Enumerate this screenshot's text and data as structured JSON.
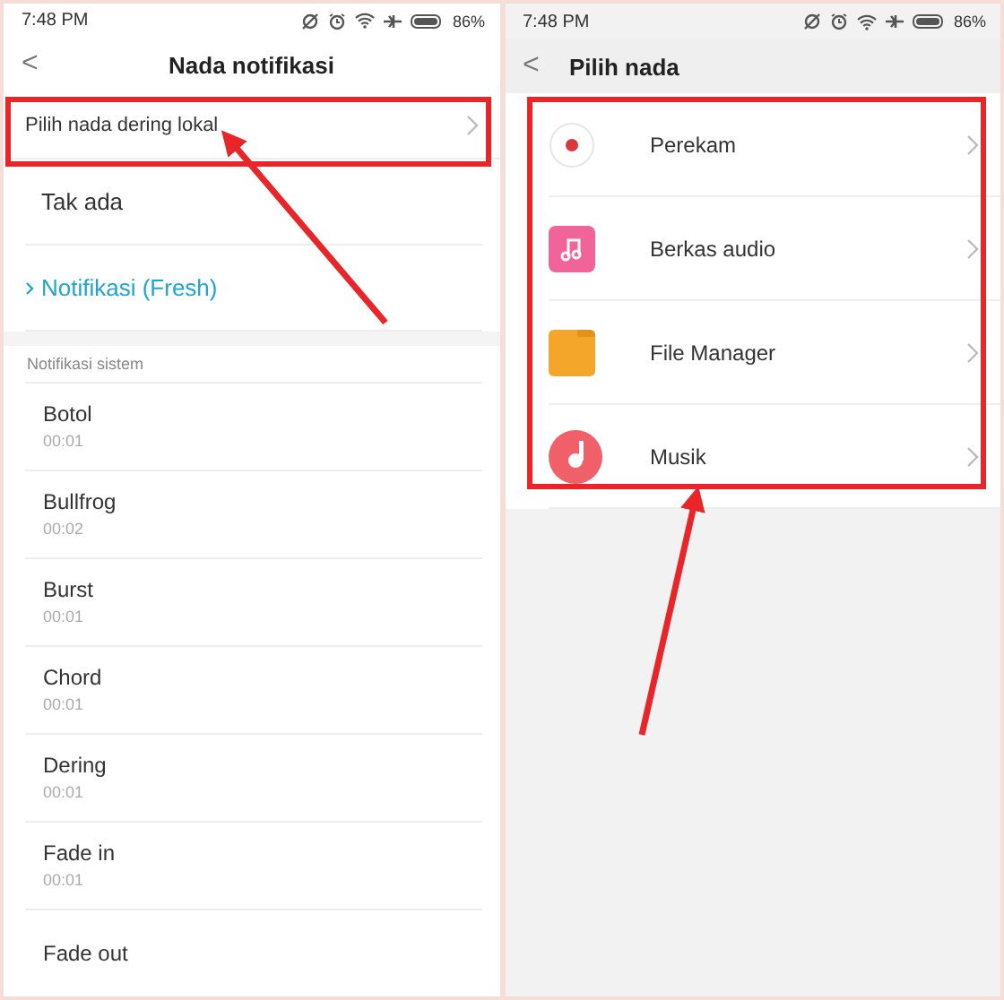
{
  "left_screen": {
    "status_bar": {
      "time": "7:48 PM",
      "battery": "86%"
    },
    "header": {
      "back": "<",
      "title": "Nada notifikasi"
    },
    "local_picker": {
      "label": "Pilih nada dering lokal"
    },
    "options": [
      {
        "label": "Tak ada",
        "selected": false
      },
      {
        "label": "Notifikasi (Fresh)",
        "selected": true
      }
    ],
    "system_section": {
      "label": "Notifikasi sistem",
      "items": [
        {
          "name": "Botol",
          "duration": "00:01",
          "selected": false
        },
        {
          "name": "Bullfrog",
          "duration": "00:02",
          "selected": false
        },
        {
          "name": "Burst",
          "duration": "00:01",
          "selected": false
        },
        {
          "name": "Chord",
          "duration": "00:01",
          "selected": false
        },
        {
          "name": "Dering",
          "duration": "00:01",
          "selected": false
        },
        {
          "name": "Fade in",
          "duration": "00:01",
          "selected": false
        },
        {
          "name": "Fade out",
          "selected": false
        }
      ]
    }
  },
  "right_screen": {
    "status_bar": {
      "time": "7:48 PM",
      "battery": "86%"
    },
    "header": {
      "back": "<",
      "title": "Pilih nada"
    },
    "sources": [
      {
        "label": "Perekam",
        "kind": "recorder"
      },
      {
        "label": "Berkas audio",
        "kind": "audio"
      },
      {
        "label": "File Manager",
        "kind": "folder"
      },
      {
        "label": "Musik",
        "kind": "music"
      }
    ]
  }
}
